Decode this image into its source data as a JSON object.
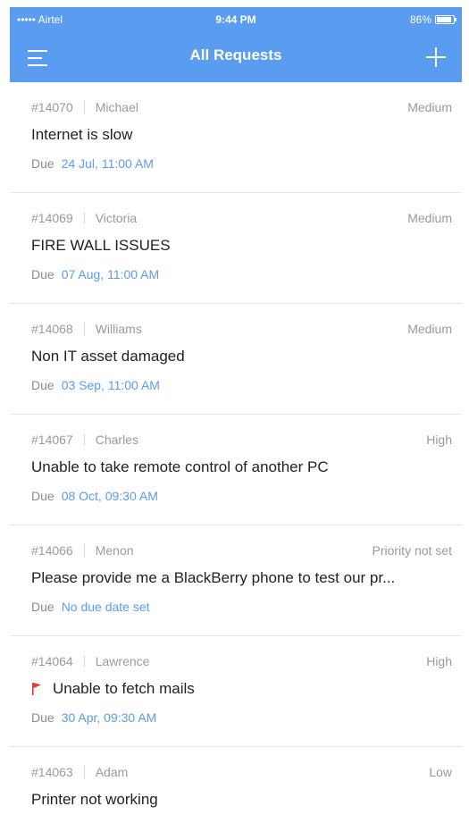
{
  "status_bar": {
    "carrier": "••••• Airtel",
    "time": "9:44 PM",
    "battery": "86%"
  },
  "header": {
    "title": "All Requests",
    "menu_icon": "menu-icon",
    "add_icon": "plus-icon"
  },
  "requests": [
    {
      "id": "#14070",
      "requester": "Michael",
      "priority": "Medium",
      "subject": "Internet is slow",
      "due_label": "Due",
      "due": "24 Jul, 11:00 AM",
      "flagged": false
    },
    {
      "id": "#14069",
      "requester": "Victoria",
      "priority": "Medium",
      "subject": "FIRE WALL ISSUES",
      "due_label": "Due",
      "due": "07 Aug, 11:00 AM",
      "flagged": false
    },
    {
      "id": "#14068",
      "requester": "Williams",
      "priority": "Medium",
      "subject": "Non IT asset damaged",
      "due_label": "Due",
      "due": "03 Sep, 11:00 AM",
      "flagged": false
    },
    {
      "id": "#14067",
      "requester": "Charles",
      "priority": "High",
      "subject": "Unable to take remote control of another PC",
      "due_label": "Due",
      "due": "08 Oct, 09:30 AM",
      "flagged": false
    },
    {
      "id": "#14066",
      "requester": "Menon",
      "priority": "Priority not set",
      "subject": "Please provide me a BlackBerry phone to test our pr...",
      "due_label": "Due",
      "due": "No due date set",
      "flagged": false
    },
    {
      "id": "#14064",
      "requester": "Lawrence",
      "priority": "High",
      "subject": "Unable to fetch mails",
      "due_label": "Due",
      "due": "30 Apr, 09:30 AM",
      "flagged": true
    },
    {
      "id": "#14063",
      "requester": "Adam",
      "priority": "Low",
      "subject": "Printer not working",
      "due_label": "",
      "due": "",
      "flagged": false
    }
  ],
  "colors": {
    "accent": "#5a9cf0",
    "flag": "#e53935"
  }
}
